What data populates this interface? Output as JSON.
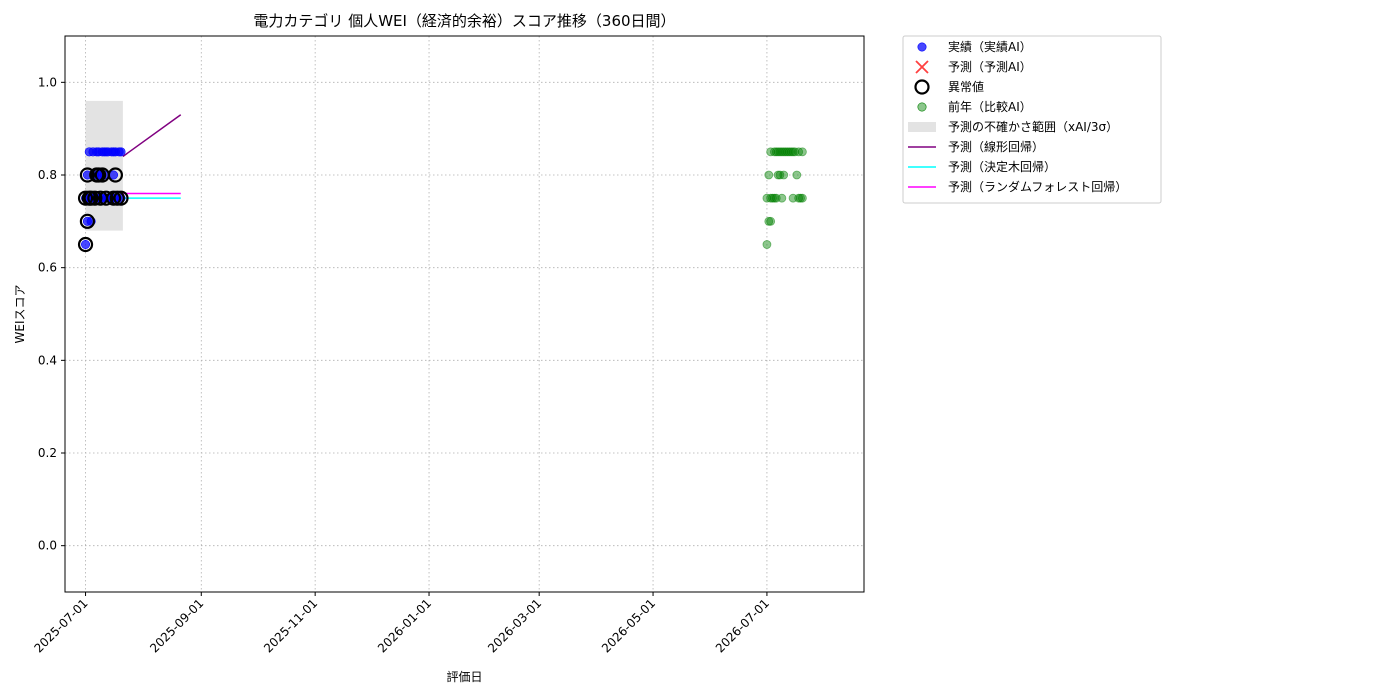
{
  "chart_data": {
    "type": "scatter",
    "title": "電力カテゴリ 個人WEI（経済的余裕）スコア推移（360日間）",
    "xlabel": "評価日",
    "ylabel": "WEIスコア",
    "xlim": [
      "2025-06-20",
      "2026-08-22"
    ],
    "ylim": [
      -0.1,
      1.1
    ],
    "grid": true,
    "legend_position": "outside-right-top",
    "x_ticks": [
      "2025-07-01",
      "2025-09-01",
      "2025-11-01",
      "2026-01-01",
      "2026-03-01",
      "2026-05-01",
      "2026-07-01"
    ],
    "y_ticks": [
      "0.0",
      "0.2",
      "0.4",
      "0.6",
      "0.8",
      "1.0"
    ],
    "legend": [
      {
        "label": "実績（実績AI）",
        "kind": "dot",
        "color": "#0000ff"
      },
      {
        "label": "予測（予測AI）",
        "kind": "cross",
        "color": "#ff0000"
      },
      {
        "label": "異常値",
        "kind": "ring",
        "color": "#000000"
      },
      {
        "label": "前年（比較AI）",
        "kind": "dot",
        "color": "#008000"
      },
      {
        "label": "予測の不確かさ範囲（xAI/3σ）",
        "kind": "band",
        "color": "#cccccc"
      },
      {
        "label": "予測（線形回帰）",
        "kind": "line",
        "color": "#800080"
      },
      {
        "label": "予測（決定木回帰）",
        "kind": "line",
        "color": "#00ffff"
      },
      {
        "label": "予測（ランダムフォレスト回帰）",
        "kind": "line",
        "color": "#ff00ff"
      }
    ],
    "series": [
      {
        "name": "実績（実績AI）",
        "color": "#0000ff",
        "points": [
          [
            "2025-07-01",
            0.65
          ],
          [
            "2025-07-01",
            0.75
          ],
          [
            "2025-07-02",
            0.8
          ],
          [
            "2025-07-02",
            0.7
          ],
          [
            "2025-07-03",
            0.85
          ],
          [
            "2025-07-03",
            0.75
          ],
          [
            "2025-07-04",
            0.7
          ],
          [
            "2025-07-04",
            0.75
          ],
          [
            "2025-07-05",
            0.85
          ],
          [
            "2025-07-05",
            0.75
          ],
          [
            "2025-07-06",
            0.75
          ],
          [
            "2025-07-06",
            0.8
          ],
          [
            "2025-07-07",
            0.85
          ],
          [
            "2025-07-07",
            0.75
          ],
          [
            "2025-07-08",
            0.8
          ],
          [
            "2025-07-08",
            0.85
          ],
          [
            "2025-07-09",
            0.75
          ],
          [
            "2025-07-09",
            0.8
          ],
          [
            "2025-07-10",
            0.85
          ],
          [
            "2025-07-10",
            0.75
          ],
          [
            "2025-07-11",
            0.8
          ],
          [
            "2025-07-11",
            0.85
          ],
          [
            "2025-07-12",
            0.75
          ],
          [
            "2025-07-12",
            0.85
          ],
          [
            "2025-07-13",
            0.75
          ],
          [
            "2025-07-13",
            0.85
          ],
          [
            "2025-07-14",
            0.75
          ],
          [
            "2025-07-15",
            0.85
          ],
          [
            "2025-07-15",
            0.75
          ],
          [
            "2025-07-16",
            0.8
          ],
          [
            "2025-07-16",
            0.85
          ],
          [
            "2025-07-17",
            0.75
          ],
          [
            "2025-07-17",
            0.85
          ],
          [
            "2025-07-18",
            0.75
          ],
          [
            "2025-07-19",
            0.85
          ],
          [
            "2025-07-20",
            0.75
          ],
          [
            "2025-07-20",
            0.85
          ]
        ]
      },
      {
        "name": "異常値",
        "color": "#000000",
        "points": [
          [
            "2025-07-01",
            0.65
          ],
          [
            "2025-07-01",
            0.75
          ],
          [
            "2025-07-02",
            0.8
          ],
          [
            "2025-07-02",
            0.7
          ],
          [
            "2025-07-03",
            0.75
          ],
          [
            "2025-07-04",
            0.75
          ],
          [
            "2025-07-06",
            0.75
          ],
          [
            "2025-07-07",
            0.8
          ],
          [
            "2025-07-08",
            0.8
          ],
          [
            "2025-07-09",
            0.75
          ],
          [
            "2025-07-10",
            0.8
          ],
          [
            "2025-07-12",
            0.75
          ],
          [
            "2025-07-16",
            0.75
          ],
          [
            "2025-07-17",
            0.8
          ],
          [
            "2025-07-18",
            0.75
          ],
          [
            "2025-07-20",
            0.75
          ]
        ]
      },
      {
        "name": "前年（比較AI）",
        "color": "#008000",
        "points": [
          [
            "2026-07-01",
            0.65
          ],
          [
            "2026-07-01",
            0.75
          ],
          [
            "2026-07-02",
            0.8
          ],
          [
            "2026-07-02",
            0.7
          ],
          [
            "2026-07-03",
            0.85
          ],
          [
            "2026-07-03",
            0.75
          ],
          [
            "2026-07-03",
            0.7
          ],
          [
            "2026-07-04",
            0.75
          ],
          [
            "2026-07-05",
            0.85
          ],
          [
            "2026-07-05",
            0.75
          ],
          [
            "2026-07-06",
            0.75
          ],
          [
            "2026-07-06",
            0.85
          ],
          [
            "2026-07-07",
            0.8
          ],
          [
            "2026-07-07",
            0.85
          ],
          [
            "2026-07-08",
            0.85
          ],
          [
            "2026-07-08",
            0.8
          ],
          [
            "2026-07-09",
            0.85
          ],
          [
            "2026-07-09",
            0.75
          ],
          [
            "2026-07-10",
            0.85
          ],
          [
            "2026-07-10",
            0.8
          ],
          [
            "2026-07-11",
            0.85
          ],
          [
            "2026-07-12",
            0.85
          ],
          [
            "2026-07-13",
            0.85
          ],
          [
            "2026-07-14",
            0.85
          ],
          [
            "2026-07-15",
            0.85
          ],
          [
            "2026-07-15",
            0.75
          ],
          [
            "2026-07-16",
            0.85
          ],
          [
            "2026-07-17",
            0.8
          ],
          [
            "2026-07-18",
            0.85
          ],
          [
            "2026-07-18",
            0.75
          ],
          [
            "2026-07-19",
            0.75
          ],
          [
            "2026-07-20",
            0.85
          ],
          [
            "2026-07-20",
            0.75
          ]
        ]
      }
    ],
    "uncertainty_band": {
      "x0": "2025-07-01",
      "x1": "2025-07-21",
      "y0": 0.68,
      "y1": 0.96
    },
    "forecast_lines": [
      {
        "name": "予測（線形回帰）",
        "color": "#800080",
        "x": [
          "2025-07-21",
          "2025-08-21"
        ],
        "y": [
          0.84,
          0.93
        ]
      },
      {
        "name": "予測（決定木回帰）",
        "color": "#00ffff",
        "x": [
          "2025-07-21",
          "2025-08-21"
        ],
        "y": [
          0.75,
          0.75
        ]
      },
      {
        "name": "予測（ランダムフォレスト回帰）",
        "color": "#ff00ff",
        "x": [
          "2025-07-21",
          "2025-08-21"
        ],
        "y": [
          0.76,
          0.76
        ]
      }
    ]
  }
}
